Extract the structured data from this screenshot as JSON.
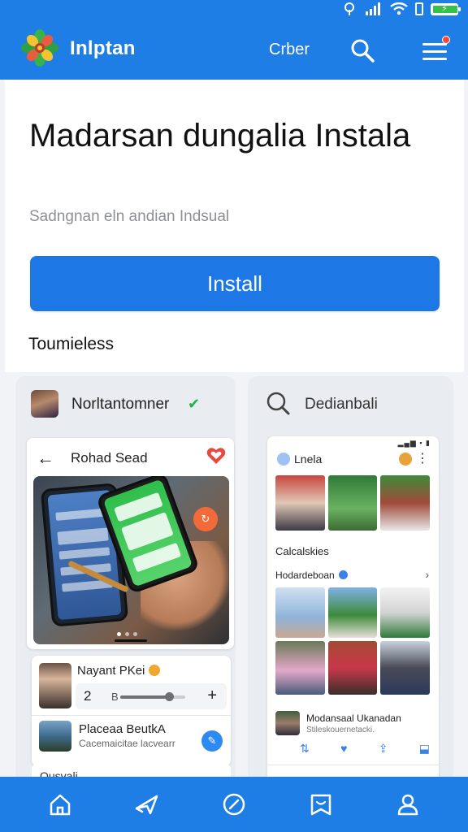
{
  "header": {
    "brand": "Inlptan",
    "link": "Crber"
  },
  "main": {
    "title": "Madarsan dungalia Instala",
    "subtitle": "Sadngnan eln andian Indsual",
    "install_button": "Install",
    "section_label": "Toumieless"
  },
  "preview_left": {
    "account_name": "Norltantomner",
    "screen_title": "Rohad Sead",
    "list": [
      {
        "name": "Nayant PKei",
        "value": "2",
        "unit": "B",
        "slider_level": 0.75
      },
      {
        "title": "Placeaa BeutkA",
        "subtitle": "Cacemaicitae lacvearr"
      },
      {
        "title": "Qusvali"
      }
    ]
  },
  "preview_right": {
    "header_name": "Dedianbali",
    "screen_title": "Lnela",
    "section1": "Calcalskies",
    "section2": "Hodardeboan",
    "post_title": "Modansaal Ukanadan",
    "post_subtitle": "Stileskouernetacki."
  },
  "icons": {
    "logo": "flower-logo-icon",
    "search": "search-icon",
    "menu": "hamburger-menu-icon",
    "nav": [
      "home-icon",
      "explore-icon",
      "compass-icon",
      "inbox-icon",
      "profile-icon"
    ]
  },
  "colors": {
    "primary": "#1f7de6",
    "install_button": "#1d78e5",
    "verified": "#1fb34a"
  }
}
